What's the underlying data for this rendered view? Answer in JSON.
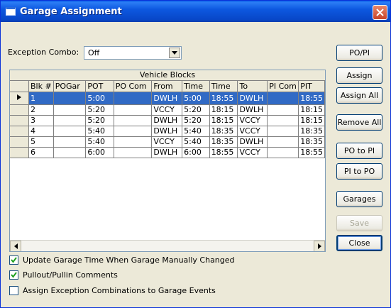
{
  "window": {
    "title": "Garage Assignment"
  },
  "exception": {
    "label": "Exception Combo:",
    "value": "Off"
  },
  "buttons": {
    "po_pi": "PO/PI",
    "assign": "Assign",
    "assign_all": "Assign All",
    "remove_all": "Remove All",
    "po_to_pi": "PO to PI",
    "pi_to_po": "PI to PO",
    "garages": "Garages",
    "save": "Save",
    "close": "Close"
  },
  "grid": {
    "caption": "Vehicle Blocks",
    "columns": [
      "Blk #",
      "POGar",
      "POT",
      "PO Com",
      "From",
      "Time",
      "Time",
      "To",
      "PI Com",
      "PIT"
    ],
    "rows": [
      [
        "1",
        "",
        "5:00",
        "",
        "DWLH",
        "5:00",
        "18:55",
        "DWLH",
        "",
        "18:55"
      ],
      [
        "2",
        "",
        "5:20",
        "",
        "VCCY",
        "5:20",
        "18:15",
        "DWLH",
        "",
        "18:15"
      ],
      [
        "3",
        "",
        "5:20",
        "",
        "DWLH",
        "5:20",
        "18:15",
        "VCCY",
        "",
        "18:15"
      ],
      [
        "4",
        "",
        "5:40",
        "",
        "DWLH",
        "5:40",
        "18:35",
        "VCCY",
        "",
        "18:35"
      ],
      [
        "5",
        "",
        "5:40",
        "",
        "VCCY",
        "5:40",
        "18:35",
        "DWLH",
        "",
        "18:35"
      ],
      [
        "6",
        "",
        "6:00",
        "",
        "DWLH",
        "6:00",
        "18:55",
        "VCCY",
        "",
        "18:55"
      ]
    ],
    "selected_row": 0
  },
  "options": [
    {
      "label": "Update Garage Time When Garage Manually Changed",
      "checked": true
    },
    {
      "label": "Pullout/Pullin Comments",
      "checked": true
    },
    {
      "label": "Assign Exception Combinations to Garage Events",
      "checked": false
    }
  ]
}
